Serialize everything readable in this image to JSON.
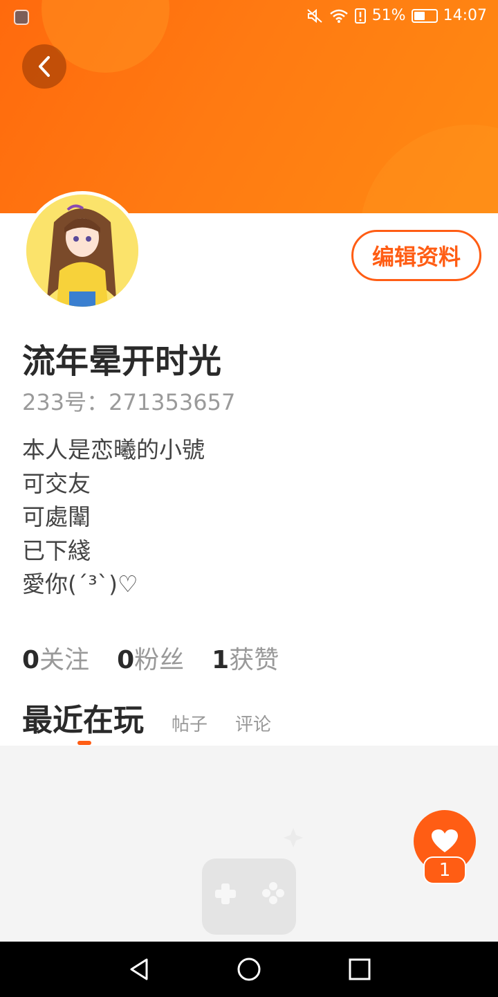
{
  "status_bar": {
    "battery_percent": "51%",
    "battery_level": 0.51,
    "time": "14:07",
    "icons": [
      "app-shield-icon",
      "mute-icon",
      "wifi-icon",
      "alert-icon",
      "battery-icon"
    ]
  },
  "header": {
    "back_icon": "chevron-left-icon"
  },
  "profile": {
    "edit_label": "编辑资料",
    "username": "流年晕开时光",
    "uid_label": "233号：271353657",
    "bio": [
      "本人是恋曦的小號",
      "可交友",
      "可處闈",
      "已下綫",
      "愛你(ˊ³ˋ)♡"
    ]
  },
  "stats": {
    "following": {
      "count": "0",
      "label": "关注"
    },
    "fans": {
      "count": "0",
      "label": "粉丝"
    },
    "likes": {
      "count": "1",
      "label": "获赞"
    }
  },
  "tabs": {
    "recent": "最近在玩",
    "posts": "帖子",
    "comments": "评论"
  },
  "like_fab": {
    "count": "1",
    "icon": "heart-icon"
  },
  "nav": {
    "icons": [
      "back-triangle-icon",
      "home-circle-icon",
      "recents-square-icon"
    ]
  },
  "colors": {
    "accent": "#ff5d14",
    "header_start": "#ff6a0d",
    "header_end": "#ff8a12"
  }
}
